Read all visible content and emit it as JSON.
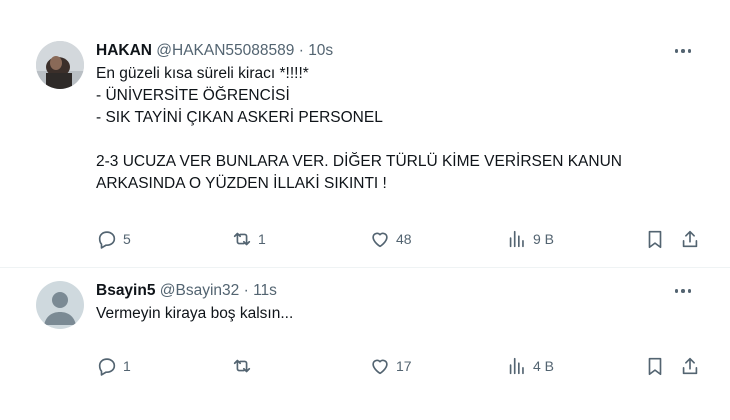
{
  "tweets": [
    {
      "name": "HAKAN",
      "handle": "@HAKAN55088589",
      "separator": "·",
      "time": "10s",
      "text": "En güzeli kısa süreli kiracı *!!!!*\n- ÜNİVERSİTE ÖĞRENCİSİ\n- SIK TAYİNİ ÇIKAN ASKERİ PERSONEL\n\n2-3 UCUZA VER BUNLARA VER. DİĞER TÜRLÜ KİME VERİRSEN KANUN ARKASINDA O YÜZDEN İLLAKİ SIKINTI !",
      "replies": "5",
      "retweets": "1",
      "likes": "48",
      "views": "9 B"
    },
    {
      "name": "Bsayin5",
      "handle": "@Bsayin32",
      "separator": "·",
      "time": "11s",
      "text": "Vermeyin kiraya boş kalsın...",
      "replies": "1",
      "retweets": "",
      "likes": "17",
      "views": "4 B"
    }
  ],
  "icons": {
    "reply": "reply-icon",
    "retweet": "retweet-icon",
    "like": "heart-icon",
    "views": "views-icon",
    "bookmark": "bookmark-icon",
    "share": "share-icon",
    "more": "more-icon"
  },
  "colors": {
    "text": "#0f1419",
    "secondary": "#536471",
    "divider": "#eff3f4"
  }
}
